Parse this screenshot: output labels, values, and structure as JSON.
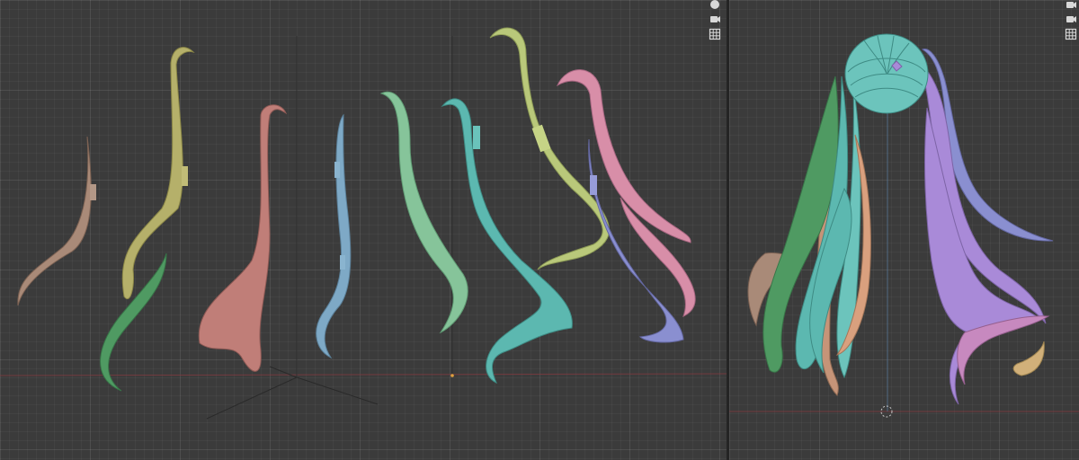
{
  "viewports": [
    {
      "name": "left-viewport",
      "gizmo_buttons": [
        "hand-icon",
        "camera-icon",
        "grid-icon"
      ]
    },
    {
      "name": "right-viewport",
      "gizmo_buttons": [
        "camera-icon",
        "grid-icon"
      ]
    }
  ],
  "colors": {
    "background": "#3b3b3b",
    "strand_tan": "#a98a78",
    "strand_olive": "#b5b06a",
    "strand_green": "#4f9a62",
    "strand_rose": "#c07e78",
    "strand_blue": "#7ea9c6",
    "strand_mint": "#86c49a",
    "strand_teal": "#5cb8b0",
    "strand_yellowgreen": "#b9c87a",
    "strand_pink": "#d88ea8",
    "strand_periwinkle": "#8a8fd0",
    "strand_lavender": "#a98ad8",
    "x_axis": "#a0424a",
    "y_axis": "#6b8fb0"
  }
}
